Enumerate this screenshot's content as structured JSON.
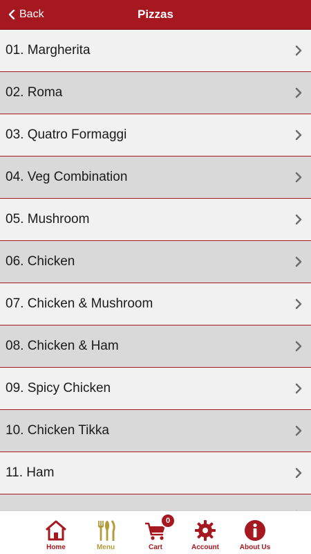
{
  "header": {
    "back_label": "Back",
    "title": "Pizzas"
  },
  "menu_items": [
    {
      "label": "01. Margherita"
    },
    {
      "label": "02. Roma"
    },
    {
      "label": "03. Quatro Formaggi"
    },
    {
      "label": "04. Veg Combination"
    },
    {
      "label": "05. Mushroom"
    },
    {
      "label": "06. Chicken"
    },
    {
      "label": "07. Chicken & Mushroom"
    },
    {
      "label": "08. Chicken & Ham"
    },
    {
      "label": "09. Spicy Chicken"
    },
    {
      "label": "10. Chicken Tikka"
    },
    {
      "label": "11. Ham"
    },
    {
      "label": ""
    }
  ],
  "tabbar": {
    "home": {
      "label": "Home",
      "icon": "home-icon"
    },
    "menu": {
      "label": "Menu",
      "icon": "cutlery-icon"
    },
    "cart": {
      "label": "Cart",
      "icon": "cart-icon",
      "count": "0"
    },
    "account": {
      "label": "Account",
      "icon": "gear-icon"
    },
    "about": {
      "label": "About Us",
      "icon": "info-icon"
    }
  },
  "colors": {
    "brand_red": "#a5181f",
    "active_gold": "#b59a3a",
    "row_light": "#f1f1f1",
    "row_dark": "#d9d9d9"
  }
}
